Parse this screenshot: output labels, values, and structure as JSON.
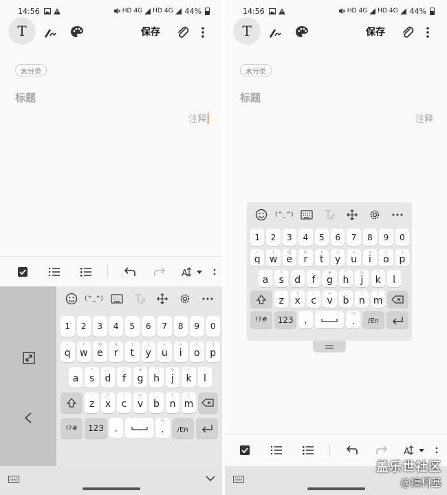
{
  "status_bar": {
    "time": "14:56",
    "net1": "HD",
    "net2": "4G",
    "net3": "HD",
    "net4": "4G",
    "battery": "44%"
  },
  "toolbar": {
    "text_mode": "T",
    "save_label": "保存"
  },
  "note": {
    "category_tag": "未分类",
    "title_placeholder": "标题",
    "annotation_placeholder": "注释"
  },
  "keyboard": {
    "emoticon_label": "(^_^)",
    "number_row": [
      "1",
      "2",
      "3",
      "4",
      "5",
      "6",
      "7",
      "8",
      "9",
      "0"
    ],
    "row_q": [
      [
        "q",
        "~"
      ],
      [
        "w",
        "|"
      ],
      [
        "e",
        "@"
      ],
      [
        "r",
        "&"
      ],
      [
        "t",
        "{"
      ],
      [
        "y",
        "}"
      ],
      [
        "u",
        "<"
      ],
      [
        "i",
        ">"
      ],
      [
        "o",
        "["
      ],
      [
        "p",
        "]"
      ]
    ],
    "row_a": [
      [
        "a",
        "`"
      ],
      [
        "s",
        "*"
      ],
      [
        "d",
        "-"
      ],
      [
        "f",
        "/"
      ],
      [
        "g",
        "#"
      ],
      [
        "h",
        "^"
      ],
      [
        "j",
        "%"
      ],
      [
        "k",
        "\""
      ],
      [
        "l",
        ";"
      ]
    ],
    "row_z": [
      [
        "z",
        ":"
      ],
      [
        "x",
        "?"
      ],
      [
        "c",
        "!"
      ],
      [
        "v",
        "="
      ],
      [
        "b",
        "_"
      ],
      [
        "n",
        "("
      ],
      [
        "m",
        ")"
      ]
    ],
    "sym_key": "!?#",
    "num_key": "123",
    "comma_key": ",",
    "period_key": ".",
    "lang_key": "/En",
    "period_hint": "!?",
    "lang_hint": "‹ ›"
  },
  "watermark": {
    "line1": "盖乐世社区",
    "line2": "@搞柯基"
  },
  "colors": {
    "accent_cursor": "#d24a2c",
    "keyboard_bg": "#e7e7e7",
    "key": "#ffffff",
    "key_gray": "#d2d2d2"
  }
}
